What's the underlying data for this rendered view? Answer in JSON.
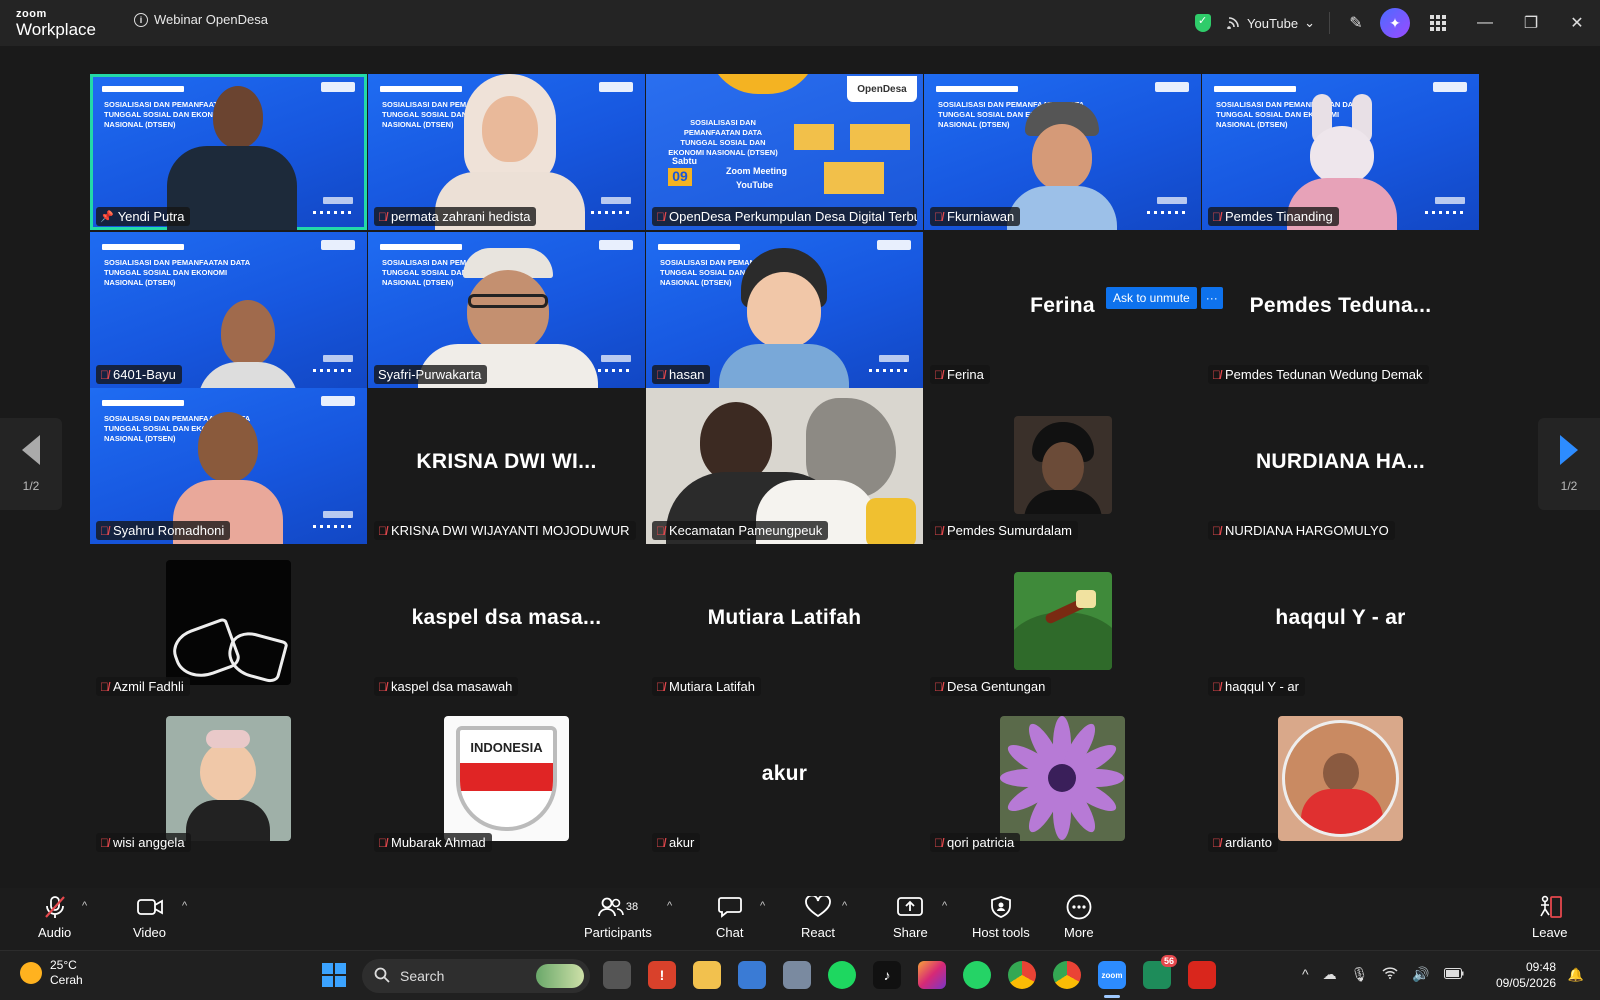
{
  "titlebar": {
    "brand_top": "zoom",
    "brand_bottom": "Workplace",
    "meeting_title": "Webinar OpenDesa",
    "live_stream_label": "YouTube",
    "icons": [
      "info-icon",
      "security-shield-icon",
      "live-stream-icon",
      "chevron-down-icon",
      "pencil-icon",
      "ai-companion-icon",
      "apps-grid-icon",
      "minimize-icon",
      "restore-icon",
      "close-icon"
    ]
  },
  "gallery": {
    "page_indicator": "1/2",
    "unmute_label": "Ask to unmute",
    "more_label": "···",
    "banner_title": "SOSIALISASI DAN PEMANFAATAN DATA TUNGGAL SOSIAL DAN EKONOMI NASIONAL (DTSEN)",
    "tiles": [
      {
        "name": "Yendi Putra",
        "kind": "video",
        "active": true,
        "muted": false
      },
      {
        "name": "permata zahrani hedista",
        "kind": "video",
        "muted": true
      },
      {
        "name": "OpenDesa Perkumpulan Desa Digital Terbu...",
        "kind": "poster",
        "muted": true
      },
      {
        "name": "Fkurniawan",
        "kind": "video",
        "muted": true
      },
      {
        "name": "Pemdes Tinanding",
        "kind": "video",
        "muted": true
      },
      {
        "name": "6401-Bayu",
        "kind": "video",
        "muted": true
      },
      {
        "name": "Syafri-Purwakarta",
        "kind": "video",
        "muted": false
      },
      {
        "name": "hasan",
        "kind": "video",
        "muted": true
      },
      {
        "name": "Ferina",
        "kind": "text",
        "display": "Ferina",
        "muted": true
      },
      {
        "name": "Pemdes Tedunan Wedung Demak",
        "kind": "text",
        "display": "Pemdes Teduna...",
        "muted": true
      },
      {
        "name": "Syahru Romadhoni",
        "kind": "video",
        "muted": true
      },
      {
        "name": "KRISNA DWI WIJAYANTI MOJODUWUR",
        "kind": "text",
        "display": "KRISNA DWI WI...",
        "muted": true
      },
      {
        "name": "Kecamatan Pameungpeuk",
        "kind": "camera",
        "muted": true
      },
      {
        "name": "Pemdes Sumurdalam",
        "kind": "avatar",
        "muted": true
      },
      {
        "name": "NURDIANA HARGOMULYO",
        "kind": "text",
        "display": "NURDIANA HA...",
        "muted": true
      },
      {
        "name": "Azmil Fadhli",
        "kind": "avatar",
        "muted": true
      },
      {
        "name": "kaspel dsa masawah",
        "kind": "text",
        "display": "kaspel dsa masa...",
        "muted": true
      },
      {
        "name": "Mutiara Latifah",
        "kind": "text",
        "display": "Mutiara Latifah",
        "muted": true
      },
      {
        "name": "Desa Gentungan",
        "kind": "avatar",
        "muted": true
      },
      {
        "name": "haqqul Y - ar",
        "kind": "text",
        "display": "haqqul Y - ar",
        "muted": true
      },
      {
        "name": "wisi anggela",
        "kind": "avatar",
        "muted": true
      },
      {
        "name": "Mubarak Ahmad",
        "kind": "avatar",
        "muted": true,
        "avatar_text": "INDONESIA"
      },
      {
        "name": "akur",
        "kind": "text",
        "display": "akur",
        "muted": true
      },
      {
        "name": "qori patricia",
        "kind": "avatar",
        "muted": true
      },
      {
        "name": "ardianto",
        "kind": "avatar",
        "muted": true
      }
    ]
  },
  "poster": {
    "brand": "OpenDesa",
    "day": "Sabtu",
    "date_num": "09",
    "platform_1": "Zoom Meeting",
    "platform_2": "YouTube"
  },
  "toolbar": {
    "audio": "Audio",
    "video": "Video",
    "participants": "Participants",
    "participants_count": "38",
    "chat": "Chat",
    "react": "React",
    "share": "Share",
    "host_tools": "Host tools",
    "more": "More",
    "leave": "Leave"
  },
  "taskbar": {
    "temperature": "25°C",
    "weather": "Cerah",
    "search_placeholder": "Search",
    "time": "09:48",
    "date": "09/05/2026",
    "badge_count": "56"
  },
  "colors": {
    "active_speaker": "#23d9a8",
    "accent_blue": "#0e72ed",
    "muted_red": "#e5484d",
    "banner_blue": "#1f6cf2"
  }
}
